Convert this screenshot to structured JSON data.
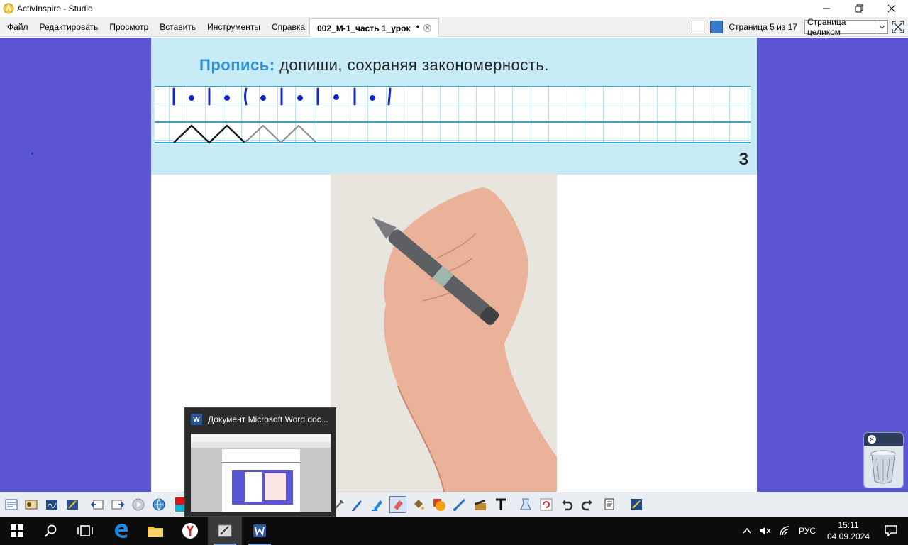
{
  "window": {
    "title": "ActivInspire - Studio",
    "controls": [
      "minimize-icon",
      "restore-icon",
      "close-icon"
    ]
  },
  "menu": {
    "items": [
      "Файл",
      "Редактировать",
      "Просмотр",
      "Вставить",
      "Инструменты",
      "Справка"
    ],
    "tab_label": "002_М-1_часть 1_урок",
    "tab_modified": "*",
    "page_count": "Страница 5 из 17",
    "zoom_value": "Страница целиком"
  },
  "flipchart": {
    "title_bold": "Пропись:",
    "title_rest": "допиши, сохраняя закономерность.",
    "page_number": "3"
  },
  "thumbnail": {
    "title": "Документ Microsoft Word.doc..."
  },
  "taskbar": {
    "apps": [
      "start-icon",
      "search-icon",
      "task-view-icon",
      "edge-icon",
      "file-explorer-icon",
      "yandex-browser-icon",
      "activinspire-icon",
      "word-icon"
    ],
    "language": "РУС",
    "time": "15:11",
    "date": "04.09.2024"
  },
  "colors": {
    "canvas_background": "#5a55d2",
    "strip": "#c7ebf5",
    "accent_title": "#2f8fd8",
    "ink": "#1e2fc8",
    "check": "#5cbf60"
  }
}
